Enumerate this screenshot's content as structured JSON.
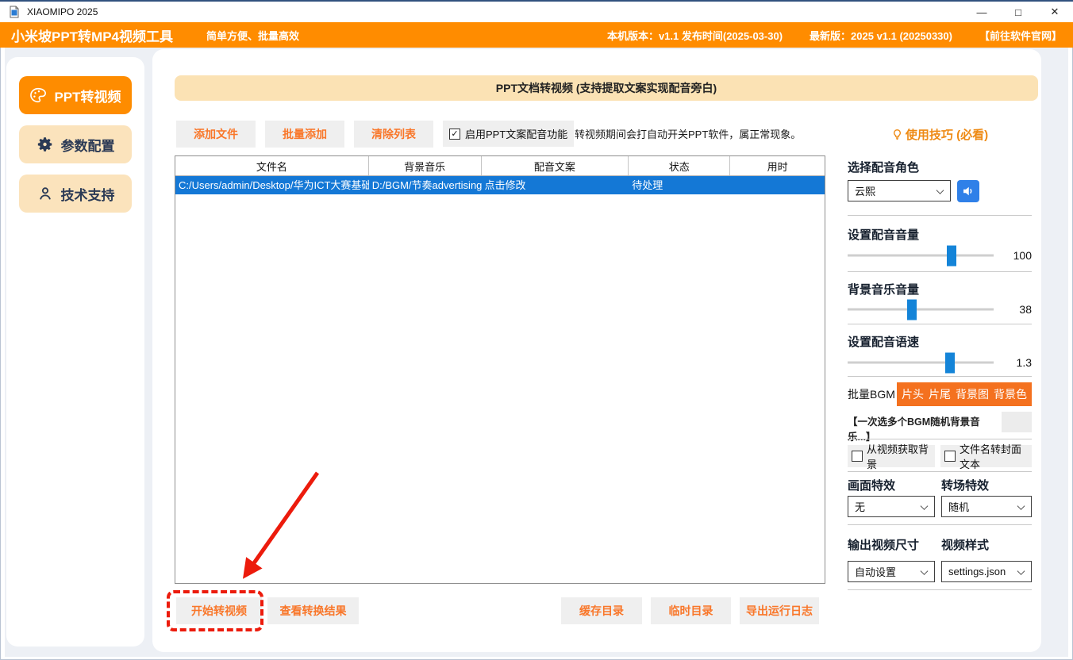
{
  "window": {
    "title": "XIAOMIPO 2025"
  },
  "icons": {
    "minimize": "—",
    "maximize": "□",
    "close": "✕",
    "check": "✓"
  },
  "colors": {
    "accent_orange": "#FF8C00",
    "cream": "#FBE2B4",
    "selected_row_blue": "#1478D6",
    "button_text_orange": "#F9772A",
    "bgm_orange": "#F4711F",
    "speaker_blue": "#2F80E8",
    "annotation_red": "#EC1B0C"
  },
  "app_bar": {
    "title": "小米坡PPT转MP4视频工具",
    "tagline": "简单方便、批量高效",
    "local_version": "本机版本：v1.1  发布时间(2025-03-30)",
    "latest_version": "最新版：2025 v1.1 (20250330)",
    "website_link": "【前往软件官网】"
  },
  "sidebar": {
    "items": [
      {
        "label": "PPT转视频",
        "icon": "palette-icon",
        "active": true
      },
      {
        "label": "参数配置",
        "icon": "gear-icon",
        "active": false
      },
      {
        "label": "技术支持",
        "icon": "person-icon",
        "active": false
      }
    ]
  },
  "main": {
    "banner": "PPT文档转视频 (支持提取文案实现配音旁白)",
    "toolbar": {
      "add_file": "添加文件",
      "batch_add": "批量添加",
      "clear_list": "清除列表",
      "voice_checkbox_label": "启用PPT文案配音功能",
      "voice_checkbox_checked": true,
      "note": "转视频期间会打自动开关PPT软件，属正常现象。"
    },
    "table": {
      "columns": [
        "文件名",
        "背景音乐",
        "配音文案",
        "状态",
        "用时"
      ],
      "rows": [
        {
          "file": "C:/Users/admin/Desktop/华为ICT大赛基础",
          "bgm": "D:/BGM/节奏advertising",
          "script": "点击修改",
          "status": "待处理",
          "time": "",
          "selected": true
        }
      ]
    },
    "footer": {
      "start": "开始转视频",
      "view_results": "查看转换结果",
      "cache_dir": "缓存目录",
      "temp_dir": "临时目录",
      "export_log": "导出运行日志"
    }
  },
  "panel": {
    "tips_label": "使用技巧 (必看)",
    "voice_role": {
      "label": "选择配音角色",
      "value": "云熙"
    },
    "voice_volume": {
      "label": "设置配音音量",
      "value": "100",
      "handle_percent": 71
    },
    "bgm_volume": {
      "label": "背景音乐音量",
      "value": "38",
      "handle_percent": 44
    },
    "voice_speed": {
      "label": "设置配音语速",
      "value": "1.3",
      "handle_percent": 70
    },
    "batch_bgm": "批量BGM",
    "bgm_tabs": [
      "片头",
      "片尾",
      "背景图",
      "背景色"
    ],
    "bgm_hint": "【一次选多个BGM随机背景音乐...】",
    "checkboxes": [
      {
        "label": "从视频获取背景",
        "checked": false
      },
      {
        "label": "文件名转封面文本",
        "checked": false
      }
    ],
    "screen_effect": {
      "label": "画面特效",
      "value": "无"
    },
    "transition_effect": {
      "label": "转场特效",
      "value": "随机"
    },
    "output_size": {
      "label": "输出视频尺寸",
      "value": "自动设置"
    },
    "video_style": {
      "label": "视频样式",
      "value": "settings.json"
    }
  }
}
